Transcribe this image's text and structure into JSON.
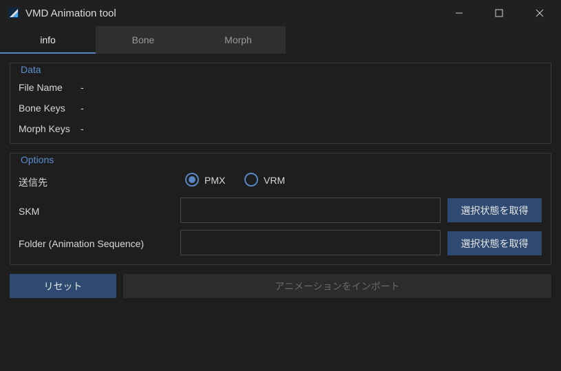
{
  "window": {
    "title": "VMD Animation tool",
    "icon": "app-icon"
  },
  "tabs": [
    {
      "label": "info",
      "active": true
    },
    {
      "label": "Bone",
      "active": false
    },
    {
      "label": "Morph",
      "active": false
    }
  ],
  "data_group": {
    "title": "Data",
    "rows": [
      {
        "label": "File Name",
        "value": "-"
      },
      {
        "label": "Bone Keys",
        "value": "-"
      },
      {
        "label": "Morph Keys",
        "value": "-"
      }
    ]
  },
  "options_group": {
    "title": "Options",
    "target_label": "送信先",
    "radios": [
      {
        "label": "PMX",
        "checked": true
      },
      {
        "label": "VRM",
        "checked": false
      }
    ],
    "skm_label": "SKM",
    "skm_value": "",
    "folder_label": "Folder (Animation Sequence)",
    "folder_value": "",
    "get_selection_label": "選択状態を取得"
  },
  "actions": {
    "reset_label": "リセット",
    "import_label": "アニメーションをインポート"
  },
  "colors": {
    "accent": "#5b86c4",
    "button": "#2e4a70",
    "background": "#1e1e1e"
  }
}
